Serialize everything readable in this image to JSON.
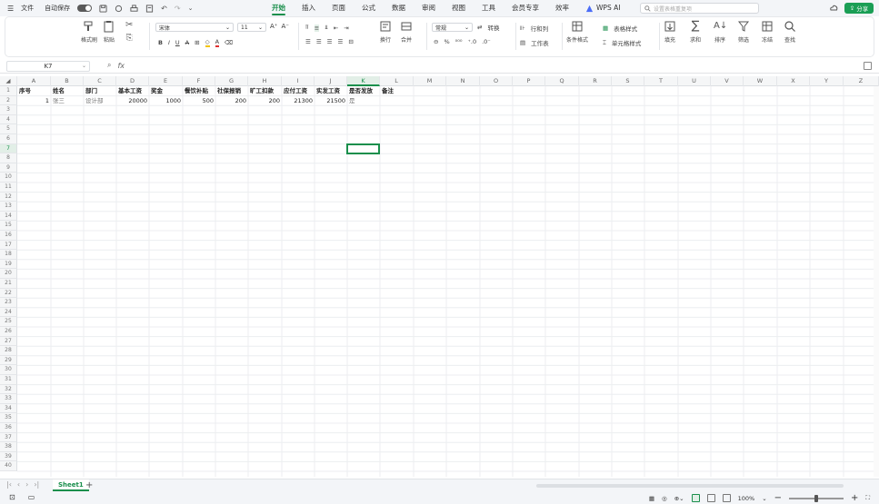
{
  "topbar": {
    "menu_label": "文件",
    "autosave_label": "自动保存",
    "tabs": [
      {
        "label": "开始",
        "active": true
      },
      {
        "label": "插入"
      },
      {
        "label": "页面"
      },
      {
        "label": "公式"
      },
      {
        "label": "数据"
      },
      {
        "label": "审阅"
      },
      {
        "label": "视图"
      },
      {
        "label": "工具"
      },
      {
        "label": "会员专享"
      },
      {
        "label": "效率"
      }
    ],
    "ai_label": "WPS AI",
    "search_placeholder": "设置表格重复项",
    "share_label": "分享",
    "accent": "#1a8f4c"
  },
  "ribbon": {
    "format_painter": "格式刷",
    "paste": "粘贴",
    "font_name": "宋体",
    "font_size": "11",
    "wrap": "换行",
    "merge": "合并",
    "number_format": "常规",
    "convert": "转换",
    "row_col": "行和列",
    "worksheet": "工作表",
    "cond_format": "条件格式",
    "table_style": "表格样式",
    "cell_style": "单元格样式",
    "fill": "填充",
    "sum": "求和",
    "sort": "排序",
    "filter": "筛选",
    "freeze": "冻结",
    "find": "查找"
  },
  "formula_bar": {
    "cell_ref": "K7",
    "fx_label": "fx",
    "formula": ""
  },
  "columns": [
    "A",
    "B",
    "C",
    "D",
    "E",
    "F",
    "G",
    "H",
    "I",
    "J",
    "K",
    "L",
    "M",
    "N",
    "O",
    "P",
    "Q",
    "R",
    "S",
    "T",
    "U",
    "V",
    "W",
    "X",
    "Y",
    "Z"
  ],
  "selected_column": "K",
  "selected_row": 7,
  "header_row": [
    "序号",
    "姓名",
    "部门",
    "基本工资",
    "奖金",
    "餐饮补贴",
    "社保报销",
    "旷工扣款",
    "应付工资",
    "实发工资",
    "是否发放",
    "备注"
  ],
  "data_rows": [
    [
      "1",
      "张三",
      "设计部",
      "20000",
      "1000",
      "500",
      "200",
      "200",
      "21300",
      "21500",
      "是",
      ""
    ]
  ],
  "sheet": {
    "tabs": [
      "Sheet1"
    ],
    "active": "Sheet1"
  },
  "status": {
    "zoom": "100%"
  }
}
